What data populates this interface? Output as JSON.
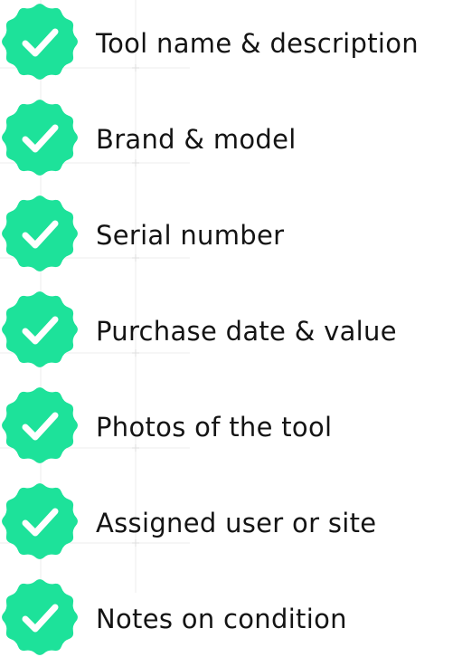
{
  "checklist": {
    "accent_color": "#1de29a",
    "check_color": "#ffffff",
    "icon": "verified-badge-check-icon",
    "items": [
      {
        "label": "Tool name & description"
      },
      {
        "label": "Brand & model"
      },
      {
        "label": "Serial number"
      },
      {
        "label": "Purchase date & value"
      },
      {
        "label": "Photos of the tool"
      },
      {
        "label": "Assigned user or site"
      },
      {
        "label": "Notes on condition"
      }
    ]
  }
}
